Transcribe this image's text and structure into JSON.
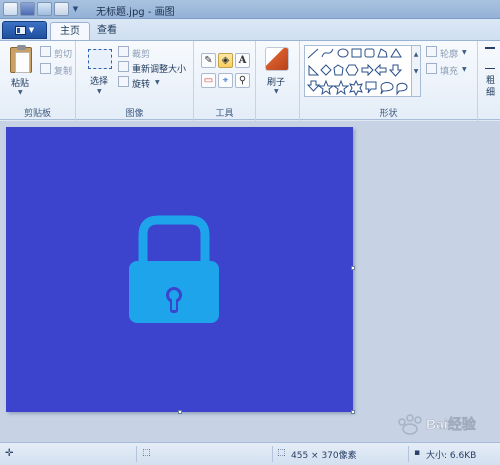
{
  "window": {
    "title": "无标题.jpg - 画图"
  },
  "file_menu": {
    "label": ""
  },
  "tabs": [
    {
      "label": "主页"
    },
    {
      "label": "查看"
    }
  ],
  "groups": {
    "clipboard": {
      "label": "剪贴板",
      "paste": "粘贴",
      "cut": "剪切",
      "copy": "复制"
    },
    "image": {
      "label": "图像",
      "select": "选择",
      "crop": "裁剪",
      "resize": "重新调整大小",
      "rotate": "旋转"
    },
    "tools": {
      "label": "工具",
      "text_tool": "A"
    },
    "brushes": {
      "label": "刷子"
    },
    "shapes": {
      "label": "形状",
      "outline": "轮廓",
      "fill": "填充"
    },
    "overflow": {
      "label_top": "粗",
      "label_bottom": "细"
    }
  },
  "canvas": {
    "background": "#3c43cc",
    "icon": "lock-icon",
    "icon_color": "#1ea4ea"
  },
  "status": {
    "dimensions": "455 × 370像素",
    "size": "大小: 6.6KB"
  },
  "watermark": {
    "text": "Bai经验"
  },
  "colors": {
    "ribbon": "#f7fafd",
    "workspace": "#c7d3e4",
    "accent": "#1f4f9e"
  }
}
